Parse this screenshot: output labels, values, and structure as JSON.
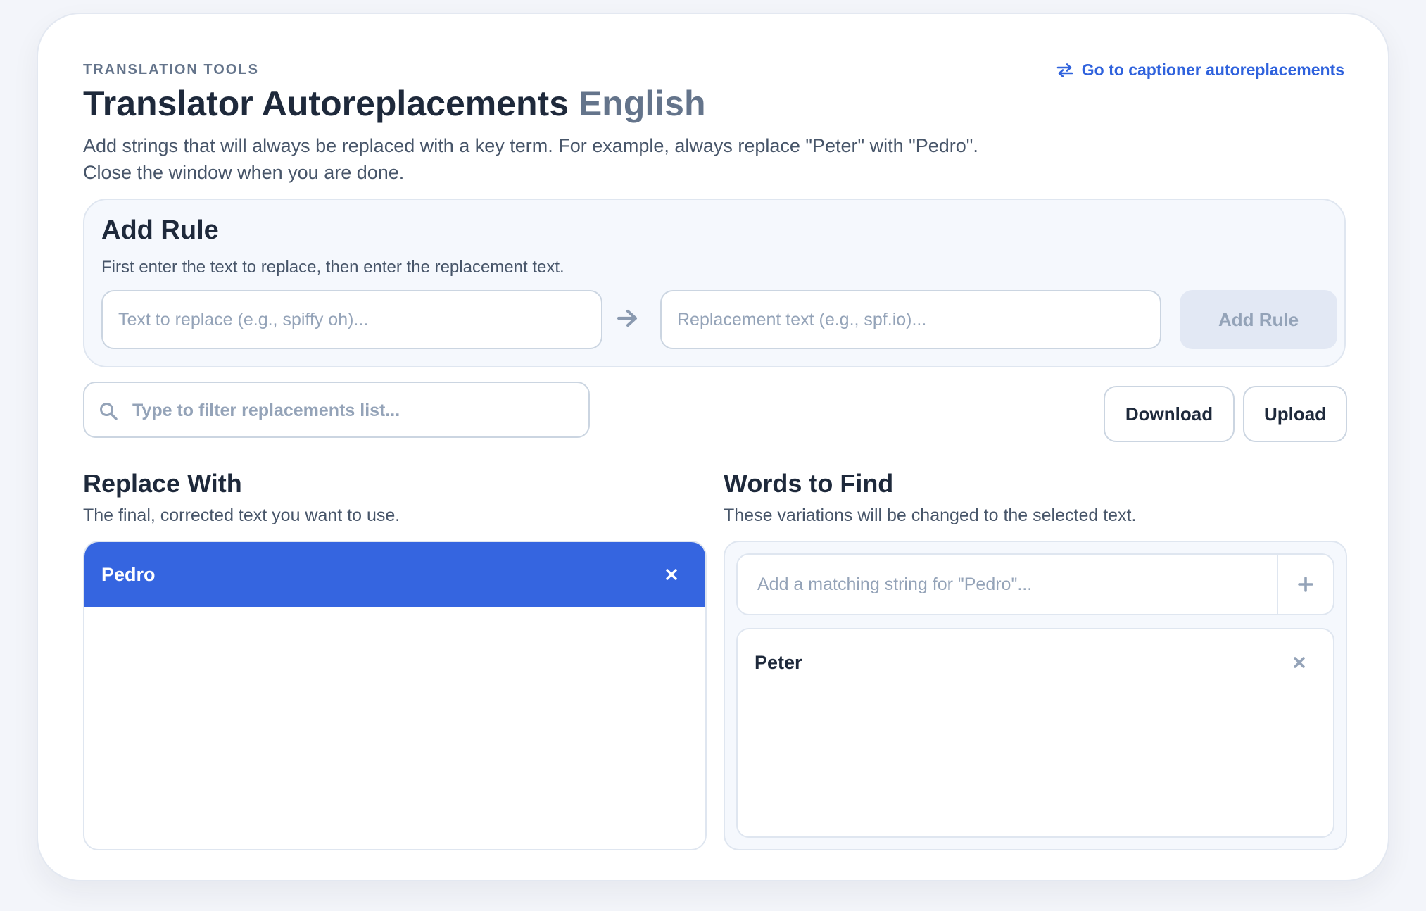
{
  "header": {
    "eyebrow": "TRANSLATION TOOLS",
    "title": "Translator Autoreplacements",
    "language": "English",
    "description": "Add strings that will always be replaced with a key term. For example, always replace \"Peter\" with \"Pedro\". Close the window when you are done.",
    "goto_link": "Go to captioner autoreplacements",
    "goto_icon": "swap-arrows-icon"
  },
  "add_rule": {
    "title": "Add Rule",
    "hint": "First enter the text to replace, then enter the replacement text.",
    "find_placeholder": "Text to replace (e.g., spiffy oh)...",
    "find_value": "",
    "replace_placeholder": "Replacement text (e.g., spf.io)...",
    "replace_value": "",
    "arrow_icon": "arrow-right-icon",
    "button_label": "Add Rule"
  },
  "filter": {
    "placeholder": "Type to filter replacements list...",
    "value": "",
    "icon": "search-icon"
  },
  "actions": {
    "download_label": "Download",
    "upload_label": "Upload"
  },
  "replace_with": {
    "title": "Replace With",
    "subtitle": "The final, corrected text you want to use.",
    "items": [
      {
        "label": "Pedro",
        "selected": true,
        "remove_icon": "close-icon"
      }
    ]
  },
  "words_to_find": {
    "title": "Words to Find",
    "subtitle": "These variations will be changed to the selected text.",
    "add_placeholder": "Add a matching string for \"Pedro\"...",
    "add_value": "",
    "add_icon": "plus-icon",
    "items": [
      {
        "label": "Peter",
        "remove_icon": "close-icon"
      }
    ]
  },
  "colors": {
    "accent": "#3565e0",
    "link": "#2f62dd",
    "text": "#1e293b",
    "muted": "#64748b",
    "placeholder": "#94a3b8",
    "background": "#f3f5fa"
  }
}
